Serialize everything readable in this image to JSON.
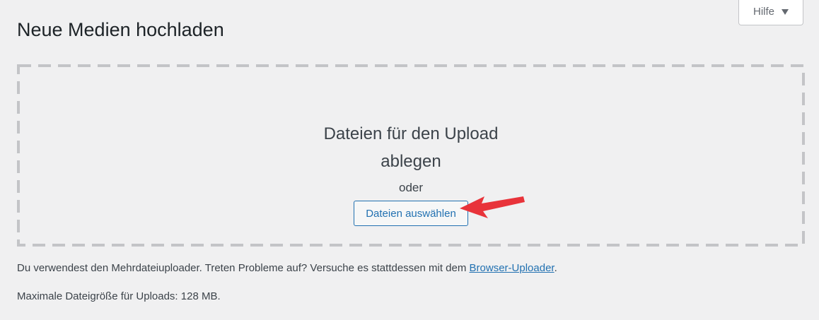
{
  "help_tab": {
    "label": "Hilfe",
    "icon": "caret-down-icon"
  },
  "page_title": "Neue Medien hochladen",
  "dropzone": {
    "line1": "Dateien für den Upload",
    "line2": "ablegen",
    "or_text": "oder",
    "select_button_label": "Dateien auswählen"
  },
  "annotation": {
    "icon": "red-arrow-icon",
    "color": "#e8333a"
  },
  "uploader_info": {
    "text": "Du verwendest den Mehrdateiuploader. Treten Probleme auf? Versuche es stattdessen mit dem ",
    "link_label": "Browser-Uploader",
    "suffix": "."
  },
  "max_upload": "Maximale Dateigröße für Uploads: 128 MB.",
  "colors": {
    "background": "#f0f0f1",
    "accent": "#2271b1",
    "dashed_border": "#c3c4c7",
    "text": "#3c434a",
    "title": "#1d2327"
  }
}
